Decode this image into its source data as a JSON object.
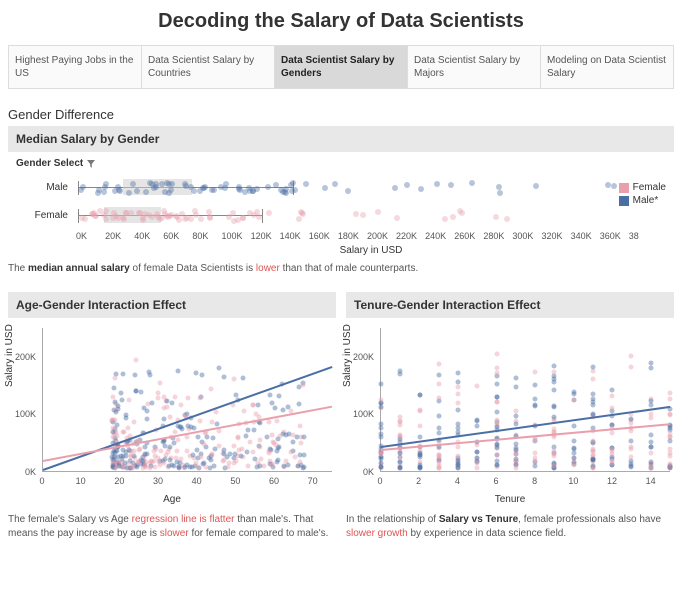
{
  "title": "Decoding the Salary of Data Scientists",
  "tabs": [
    {
      "label": "Highest Paying Jobs in the US",
      "active": false
    },
    {
      "label": "Data Scientist Salary by Countries",
      "active": false
    },
    {
      "label": "Data Scientist Salary by Genders",
      "active": true
    },
    {
      "label": "Data Scientist Salary by Majors",
      "active": false
    },
    {
      "label": "Modeling on Data Scientist Salary",
      "active": false
    }
  ],
  "section_label": "Gender Difference",
  "boxplot": {
    "title": "Median Salary by Gender",
    "selector_label": "Gender Select",
    "legend": [
      {
        "label": "Female",
        "color": "#e9a0ad"
      },
      {
        "label": "Male*",
        "color": "#4a6fa5"
      }
    ],
    "xlabel": "Salary in USD",
    "xticks": [
      "0K",
      "20K",
      "40K",
      "60K",
      "80K",
      "100K",
      "120K",
      "140K",
      "160K",
      "180K",
      "200K",
      "220K",
      "240K",
      "260K",
      "280K",
      "300K",
      "320K",
      "340K",
      "360K",
      "38"
    ],
    "rows": [
      {
        "label": "Male"
      },
      {
        "label": "Female"
      }
    ]
  },
  "note1_pre": "The ",
  "note1_b1": "median annual salary",
  "note1_mid": " of female Data Scientists is ",
  "note1_hl": "lower",
  "note1_post": " than that of male counterparts.",
  "scatter_left": {
    "title": "Age-Gender Interaction Effect",
    "xlabel": "Age",
    "ylabel": "Salary in USD",
    "xticks": [
      "0",
      "10",
      "20",
      "30",
      "40",
      "50",
      "60",
      "70"
    ],
    "yticks": [
      "0K",
      "100K",
      "200K"
    ]
  },
  "scatter_right": {
    "title": "Tenure-Gender Interaction Effect",
    "xlabel": "Tenure",
    "ylabel": "Salary in USD",
    "xticks": [
      "0",
      "2",
      "4",
      "6",
      "8",
      "10",
      "12",
      "14"
    ],
    "yticks": [
      "0K",
      "100K",
      "200K"
    ]
  },
  "note2_pre": "The female's Salary vs Age ",
  "note2_hl1": "regression line is flatter",
  "note2_mid": " than male's. That means the pay increase by age is ",
  "note2_hl2": "slower",
  "note2_post": " for female compared to male's.",
  "note3_pre": "In the relationship of ",
  "note3_b": "Salary vs Tenure",
  "note3_mid": ", female professionals also have ",
  "note3_hl": "slower growth",
  "note3_post": " by experience in data science field.",
  "colors": {
    "female": "#e9a0ad",
    "male": "#4a6fa5"
  },
  "chart_data": [
    {
      "type": "boxplot-strip",
      "title": "Median Salary by Gender",
      "xlabel": "Salary in USD",
      "xlim": [
        0,
        380000
      ],
      "series": [
        {
          "name": "Male",
          "q1": 30000,
          "median": 55000,
          "q3": 75000,
          "whisker_low": 1000,
          "whisker_high": 140000,
          "outliers_to": 360000,
          "color": "#4a6fa5"
        },
        {
          "name": "Female",
          "q1": 18000,
          "median": 40000,
          "q3": 55000,
          "whisker_low": 1000,
          "whisker_high": 120000,
          "outliers_to": 300000,
          "color": "#e9a0ad"
        }
      ]
    },
    {
      "type": "scatter",
      "title": "Age-Gender Interaction Effect",
      "xlabel": "Age",
      "ylabel": "Salary in USD",
      "xlim": [
        0,
        75
      ],
      "ylim": [
        0,
        250000
      ],
      "regression": [
        {
          "name": "Male",
          "x0": 0,
          "y0": -10000,
          "x1": 75,
          "y1": 180000,
          "color": "#4a6fa5"
        },
        {
          "name": "Female",
          "x0": 0,
          "y0": 15000,
          "x1": 75,
          "y1": 110000,
          "color": "#e9a0ad"
        }
      ],
      "point_density_note": "dense cluster age 20–35, salary 10K–150K; sparse above 50"
    },
    {
      "type": "scatter",
      "title": "Tenure-Gender Interaction Effect",
      "xlabel": "Tenure",
      "ylabel": "Salary in USD",
      "xlim": [
        0,
        15
      ],
      "ylim": [
        0,
        250000
      ],
      "regression": [
        {
          "name": "Male",
          "x0": 0,
          "y0": 40000,
          "x1": 15,
          "y1": 110000,
          "color": "#4a6fa5"
        },
        {
          "name": "Female",
          "x0": 0,
          "y0": 35000,
          "x1": 15,
          "y1": 80000,
          "color": "#e9a0ad"
        }
      ],
      "point_density_note": "vertical strips at integer tenures 0–15, salary 10K–230K"
    }
  ]
}
